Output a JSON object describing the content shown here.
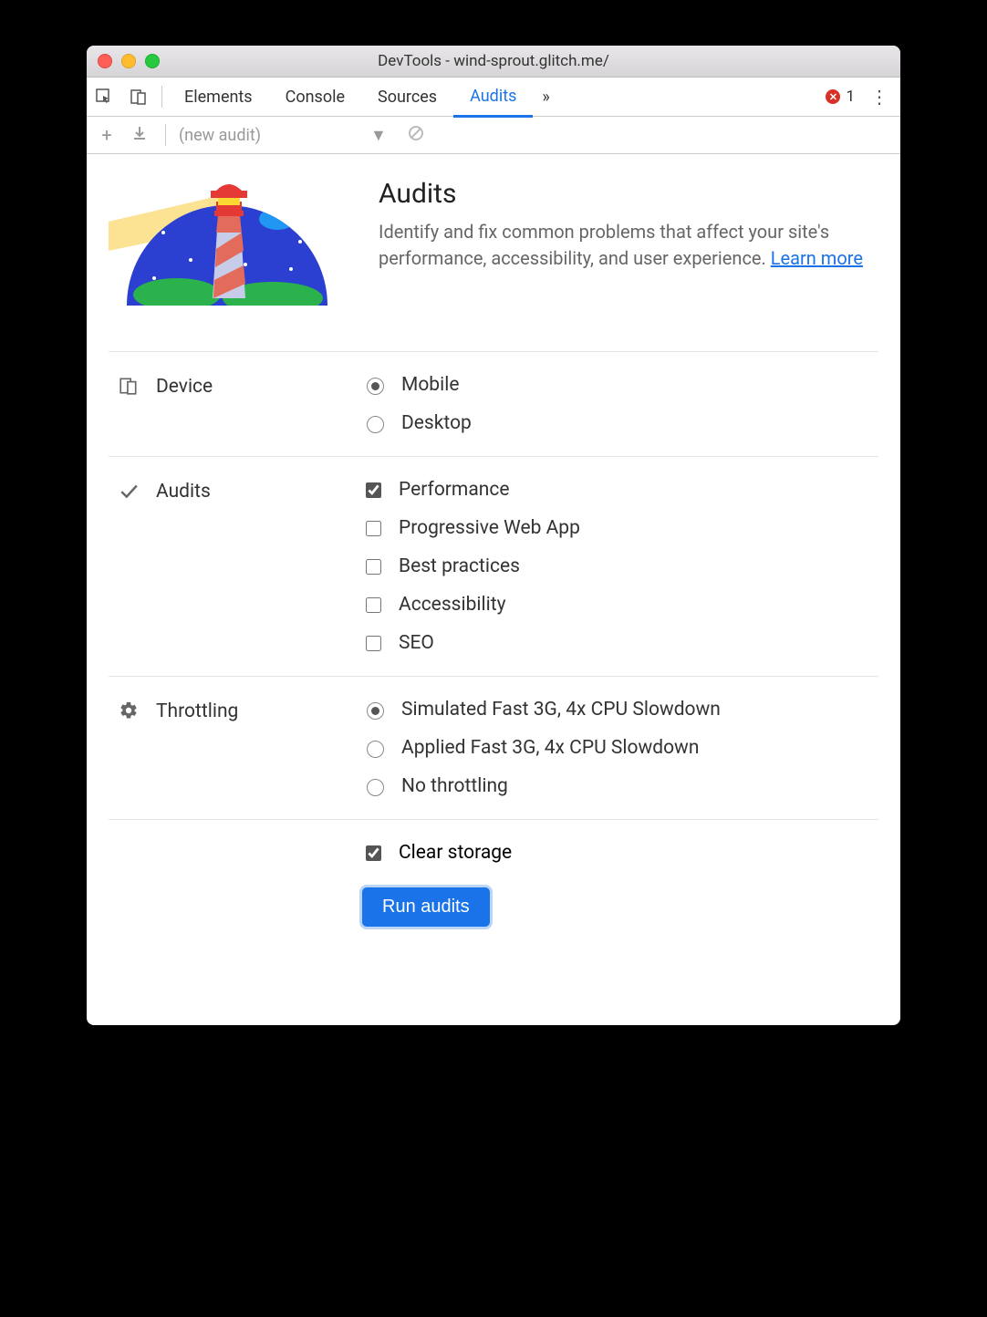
{
  "window": {
    "title": "DevTools - wind-sprout.glitch.me/"
  },
  "tabs": {
    "elements": "Elements",
    "console": "Console",
    "sources": "Sources",
    "audits": "Audits"
  },
  "errors": {
    "count": "1"
  },
  "toolbar": {
    "new_audit": "(new audit)"
  },
  "hero": {
    "title": "Audits",
    "desc_a": "Identify and fix common problems that affect your site's performance, accessibility, and user experience. ",
    "learn_more": "Learn more"
  },
  "sections": {
    "device": {
      "label": "Device",
      "options": {
        "mobile": "Mobile",
        "desktop": "Desktop"
      },
      "selected": "mobile"
    },
    "audits": {
      "label": "Audits",
      "options": {
        "performance": "Performance",
        "pwa": "Progressive Web App",
        "best": "Best practices",
        "a11y": "Accessibility",
        "seo": "SEO"
      },
      "checked": {
        "performance": true,
        "pwa": false,
        "best": false,
        "a11y": false,
        "seo": false
      }
    },
    "throttling": {
      "label": "Throttling",
      "options": {
        "sim": "Simulated Fast 3G, 4x CPU Slowdown",
        "app": "Applied Fast 3G, 4x CPU Slowdown",
        "none": "No throttling"
      },
      "selected": "sim"
    },
    "clear_storage": {
      "label": "Clear storage",
      "checked": true
    }
  },
  "run_button": "Run audits"
}
